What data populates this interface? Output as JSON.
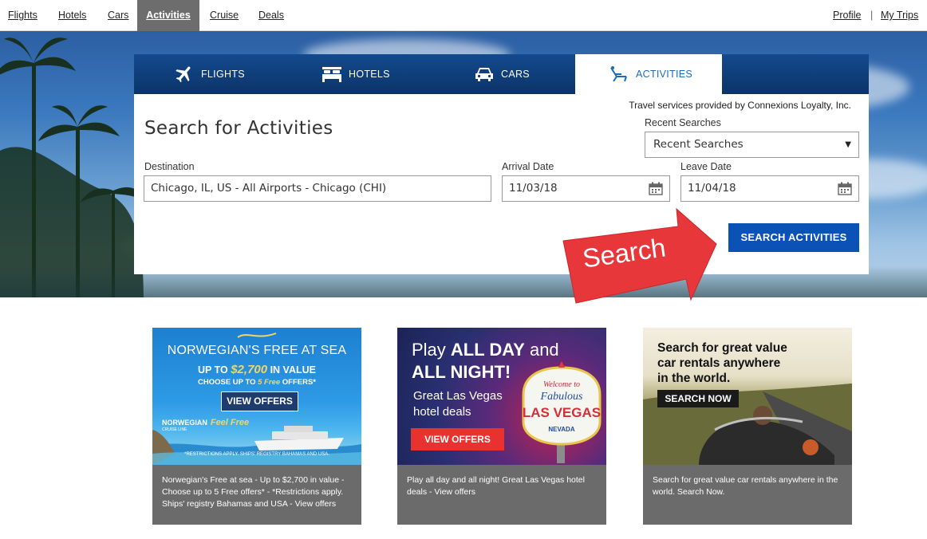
{
  "topnav": {
    "items": [
      {
        "label": "Flights"
      },
      {
        "label": "Hotels"
      },
      {
        "label": "Cars"
      },
      {
        "label": "Activities"
      },
      {
        "label": "Cruise"
      },
      {
        "label": "Deals"
      }
    ],
    "active": "Activities",
    "profile": "Profile",
    "separator": "|",
    "my_trips": "My Trips"
  },
  "search": {
    "tabs": [
      {
        "label": "FLIGHTS",
        "icon": "airplane-icon"
      },
      {
        "label": "HOTELS",
        "icon": "bed-icon"
      },
      {
        "label": "CARS",
        "icon": "car-icon"
      },
      {
        "label": "ACTIVITIES",
        "icon": "beach-chair-icon"
      }
    ],
    "active_tab": "ACTIVITIES",
    "provided_by": "Travel services provided by Connexions Loyalty, Inc.",
    "title": "Search for Activities",
    "recent_label": "Recent Searches",
    "recent_value": "Recent Searches",
    "destination_label": "Destination",
    "destination_value": "Chicago, IL, US - All Airports - Chicago (CHI)",
    "arrival_label": "Arrival Date",
    "arrival_value": "11/03/18",
    "leave_label": "Leave Date",
    "leave_value": "11/04/18",
    "button": "SEARCH ACTIVITIES"
  },
  "annotation": {
    "label": "Search",
    "color": "#e8373a"
  },
  "promos": [
    {
      "headline": "NORWEGIAN'S FREE AT SEA",
      "line2_prefix": "UP TO ",
      "line2_amount": "$2,700",
      "line2_suffix": " IN VALUE",
      "line3_prefix": "CHOOSE UP TO ",
      "line3_em": "5 Free",
      "line3_suffix": " OFFERS*",
      "button": "VIEW OFFERS",
      "logo_text": "NORWEGIAN",
      "logo_tag": "Feel Free",
      "logo_sub": "CRUISE LINE",
      "restrictions": "*RESTRICTIONS APPLY. SHIPS' REGISTRY BAHAMAS AND USA.",
      "caption": "Norwegian's Free at sea - Up to $2,700 in value - Choose up to 5 Free offers* - *Restrictions apply. Ships' registry Bahamas and USA - View offers"
    },
    {
      "headline_pre": "Play ",
      "headline_b1": "ALL DAY",
      "headline_post": " and",
      "headline_b2": "ALL NIGHT!",
      "sub1": "Great Las Vegas",
      "sub2": "hotel deals",
      "sign_top": "Welcome to",
      "sign_mid": "Fabulous",
      "sign_main": "LAS VEGAS",
      "sign_bottom": "NEVADA",
      "button": "VIEW OFFERS",
      "caption": "Play all day and all night! Great Las Vegas hotel deals - View offers"
    },
    {
      "headline1": "Search for great value",
      "headline2": "car rentals anywhere",
      "headline3": "in the world.",
      "button": "SEARCH NOW",
      "caption": "Search for great value car rentals anywhere in the world. Search Now."
    }
  ]
}
